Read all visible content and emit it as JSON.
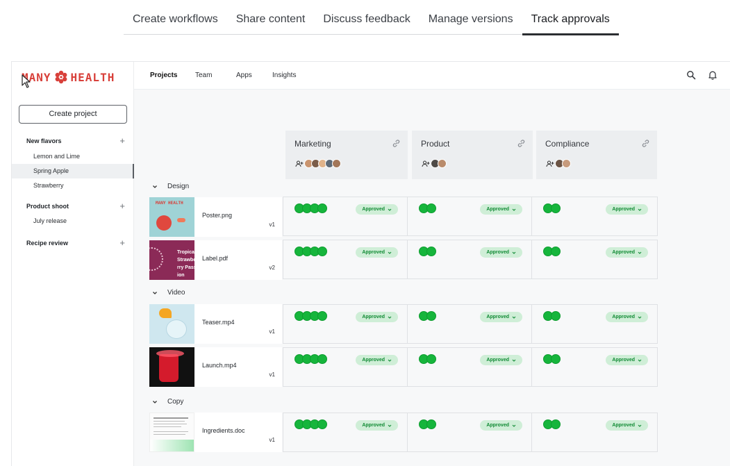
{
  "feature_tabs": [
    {
      "label": "Create workflows",
      "active": false
    },
    {
      "label": "Share content",
      "active": false
    },
    {
      "label": "Discuss feedback",
      "active": false
    },
    {
      "label": "Manage versions",
      "active": false
    },
    {
      "label": "Track approvals",
      "active": true
    }
  ],
  "brand": {
    "left": "MANY",
    "right": "HEALTH",
    "color": "#d8403a"
  },
  "sidebar": {
    "create_label": "Create project",
    "groups": [
      {
        "title": "New flavors",
        "items": [
          "Lemon and Lime",
          "Spring Apple",
          "Strawberry"
        ],
        "selected": "Spring Apple"
      },
      {
        "title": "Product shoot",
        "items": [
          "July release"
        ]
      },
      {
        "title": "Recipe review",
        "items": []
      }
    ]
  },
  "topnav": {
    "items": [
      "Projects",
      "Team",
      "Apps",
      "Insights"
    ],
    "active": "Projects"
  },
  "columns": [
    "Marketing",
    "Product",
    "Compliance"
  ],
  "groups": [
    {
      "label": "Design",
      "files": [
        {
          "name": "Poster.png",
          "version": "v1",
          "thumb_text": "MANY HEALTH"
        },
        {
          "name": "Label.pdf",
          "version": "v2",
          "thumb_text": "Tropical Strawberry Passion"
        }
      ]
    },
    {
      "label": "Video",
      "files": [
        {
          "name": "Teaser.mp4",
          "version": "v1"
        },
        {
          "name": "Launch.mp4",
          "version": "v1"
        }
      ]
    },
    {
      "label": "Copy",
      "files": [
        {
          "name": "Ingredients.doc",
          "version": "v1"
        }
      ]
    }
  ],
  "status_label": "Approved",
  "colors": {
    "approved_dot": "#16b53c",
    "badge_bg": "#cfeed7",
    "badge_text": "#0f8a33"
  },
  "icons": [
    "search-icon",
    "bell-icon",
    "link-icon",
    "add-person-icon",
    "chevron-down-icon"
  ]
}
